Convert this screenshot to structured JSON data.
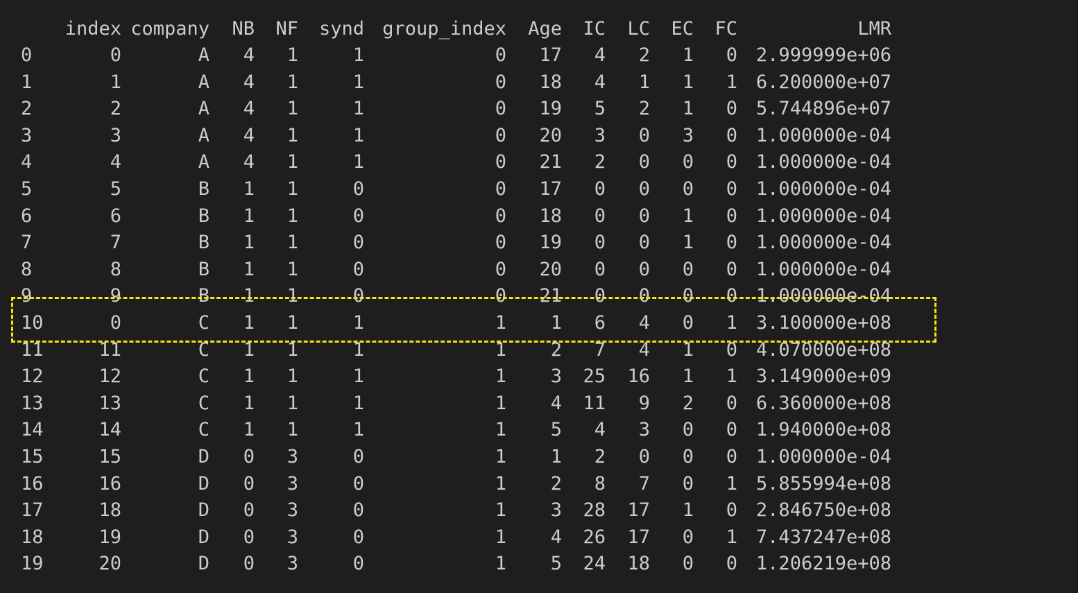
{
  "terminal": {
    "highlight_color": "#f5e313",
    "background": "#1e1e1e",
    "text_color": "#cccccc"
  },
  "table": {
    "columns": [
      "index",
      "company",
      "NB",
      "NF",
      "synd",
      "group_index",
      "Age",
      "IC",
      "LC",
      "EC",
      "FC",
      "LMR"
    ],
    "rows": [
      {
        "row": "0",
        "values": [
          "0",
          "A",
          "4",
          "1",
          "1",
          "0",
          "17",
          "4",
          "2",
          "1",
          "0",
          "2.999999e+06"
        ]
      },
      {
        "row": "1",
        "values": [
          "1",
          "A",
          "4",
          "1",
          "1",
          "0",
          "18",
          "4",
          "1",
          "1",
          "1",
          "6.200000e+07"
        ]
      },
      {
        "row": "2",
        "values": [
          "2",
          "A",
          "4",
          "1",
          "1",
          "0",
          "19",
          "5",
          "2",
          "1",
          "0",
          "5.744896e+07"
        ]
      },
      {
        "row": "3",
        "values": [
          "3",
          "A",
          "4",
          "1",
          "1",
          "0",
          "20",
          "3",
          "0",
          "3",
          "0",
          "1.000000e-04"
        ]
      },
      {
        "row": "4",
        "values": [
          "4",
          "A",
          "4",
          "1",
          "1",
          "0",
          "21",
          "2",
          "0",
          "0",
          "0",
          "1.000000e-04"
        ]
      },
      {
        "row": "5",
        "values": [
          "5",
          "B",
          "1",
          "1",
          "0",
          "0",
          "17",
          "0",
          "0",
          "0",
          "0",
          "1.000000e-04"
        ]
      },
      {
        "row": "6",
        "values": [
          "6",
          "B",
          "1",
          "1",
          "0",
          "0",
          "18",
          "0",
          "0",
          "1",
          "0",
          "1.000000e-04"
        ]
      },
      {
        "row": "7",
        "values": [
          "7",
          "B",
          "1",
          "1",
          "0",
          "0",
          "19",
          "0",
          "0",
          "1",
          "0",
          "1.000000e-04"
        ]
      },
      {
        "row": "8",
        "values": [
          "8",
          "B",
          "1",
          "1",
          "0",
          "0",
          "20",
          "0",
          "0",
          "0",
          "0",
          "1.000000e-04"
        ]
      },
      {
        "row": "9",
        "values": [
          "9",
          "B",
          "1",
          "1",
          "0",
          "0",
          "21",
          "0",
          "0",
          "0",
          "0",
          "1.000000e-04"
        ]
      },
      {
        "row": "10",
        "values": [
          "0",
          "C",
          "1",
          "1",
          "1",
          "1",
          "1",
          "6",
          "4",
          "0",
          "1",
          "3.100000e+08"
        ]
      },
      {
        "row": "11",
        "values": [
          "11",
          "C",
          "1",
          "1",
          "1",
          "1",
          "2",
          "7",
          "4",
          "1",
          "0",
          "4.070000e+08"
        ]
      },
      {
        "row": "12",
        "values": [
          "12",
          "C",
          "1",
          "1",
          "1",
          "1",
          "3",
          "25",
          "16",
          "1",
          "1",
          "3.149000e+09"
        ]
      },
      {
        "row": "13",
        "values": [
          "13",
          "C",
          "1",
          "1",
          "1",
          "1",
          "4",
          "11",
          "9",
          "2",
          "0",
          "6.360000e+08"
        ]
      },
      {
        "row": "14",
        "values": [
          "14",
          "C",
          "1",
          "1",
          "1",
          "1",
          "5",
          "4",
          "3",
          "0",
          "0",
          "1.940000e+08"
        ]
      },
      {
        "row": "15",
        "values": [
          "15",
          "D",
          "0",
          "3",
          "0",
          "1",
          "1",
          "2",
          "0",
          "0",
          "0",
          "1.000000e-04"
        ]
      },
      {
        "row": "16",
        "values": [
          "16",
          "D",
          "0",
          "3",
          "0",
          "1",
          "2",
          "8",
          "7",
          "0",
          "1",
          "5.855994e+08"
        ]
      },
      {
        "row": "17",
        "values": [
          "18",
          "D",
          "0",
          "3",
          "0",
          "1",
          "3",
          "28",
          "17",
          "1",
          "0",
          "2.846750e+08"
        ]
      },
      {
        "row": "18",
        "values": [
          "19",
          "D",
          "0",
          "3",
          "0",
          "1",
          "4",
          "26",
          "17",
          "0",
          "1",
          "7.437247e+08"
        ]
      },
      {
        "row": "19",
        "values": [
          "20",
          "D",
          "0",
          "3",
          "0",
          "1",
          "5",
          "24",
          "18",
          "0",
          "0",
          "1.206219e+08"
        ]
      }
    ],
    "highlighted_row": "10"
  }
}
